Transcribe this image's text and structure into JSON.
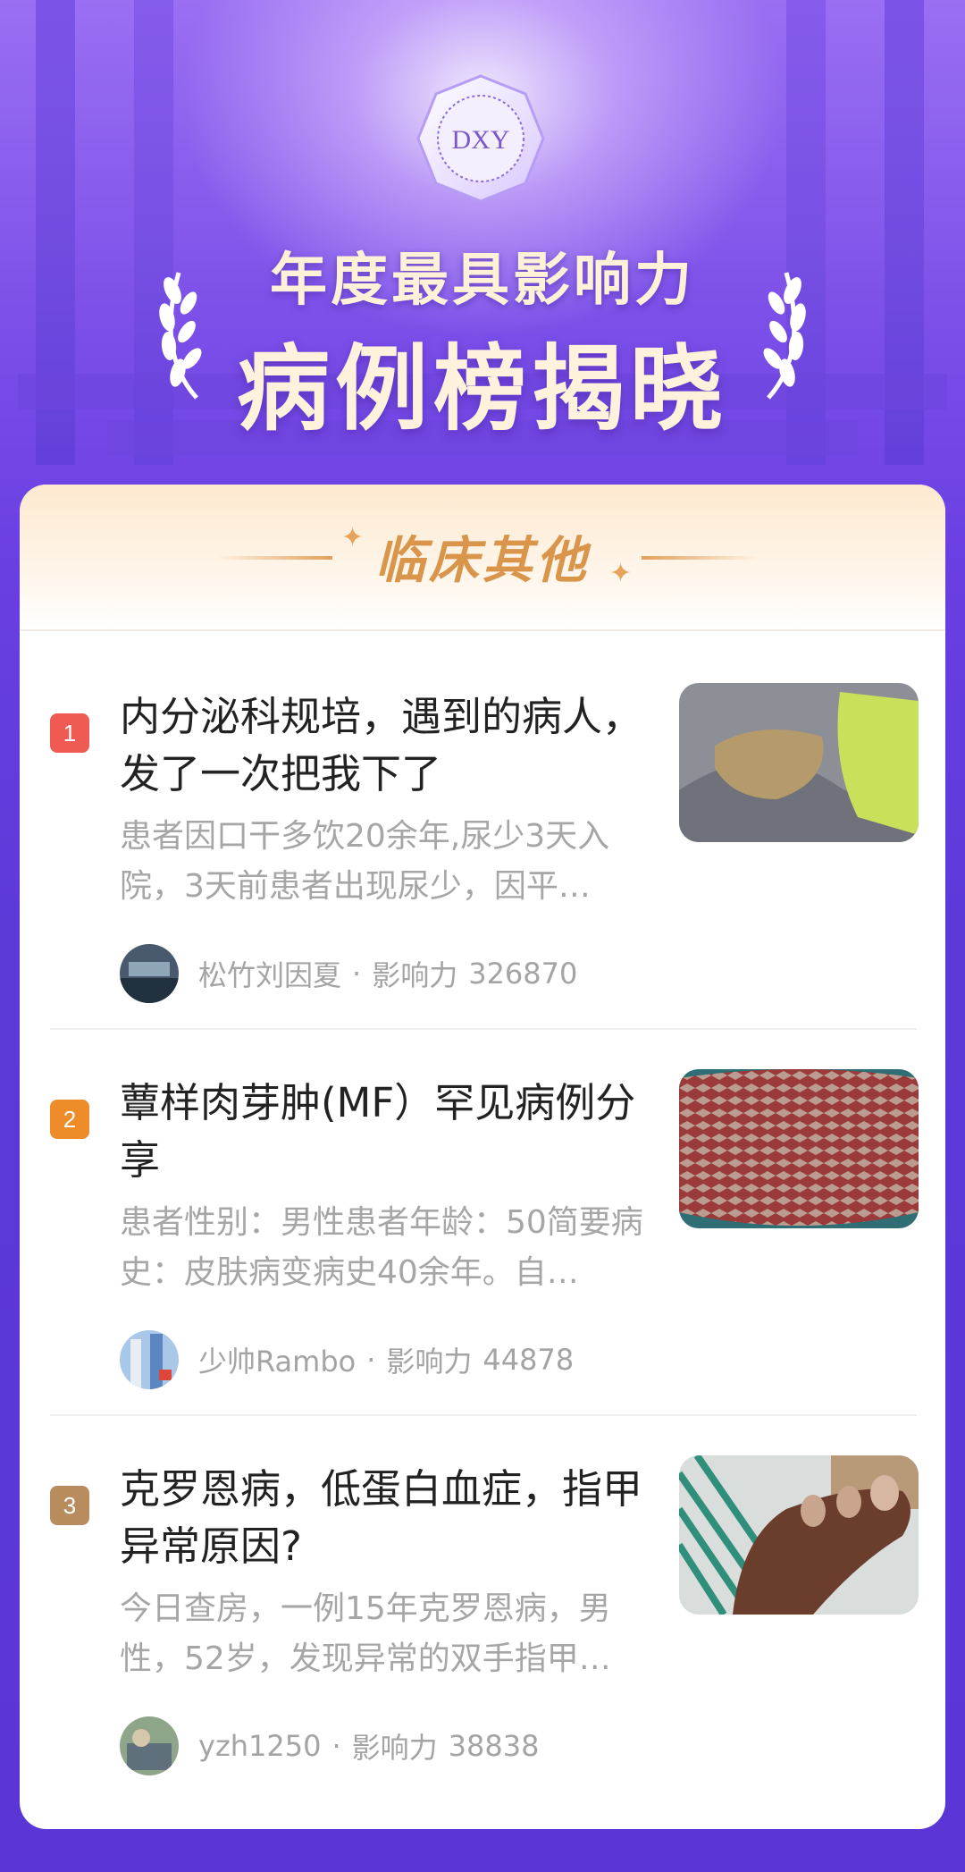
{
  "hero": {
    "emblem_text": "DXY",
    "title_line1": "年度最具影响力",
    "title_line2": "病例榜揭晓"
  },
  "category": {
    "title": "临床其他"
  },
  "items": [
    {
      "rank": "1",
      "rank_color": "#ef5a52",
      "title": "内分泌科规培，遇到的病人，发了一次把我下了",
      "desc": "患者因口干多饮20余年,尿少3天入院，3天前患者出现尿少，因平…",
      "author": "松竹刘因夏",
      "separator": "·",
      "influence_label": "影响力",
      "influence_value": "326870"
    },
    {
      "rank": "2",
      "rank_color": "#ef8c2a",
      "title": "蕈样肉芽肿(MF）罕见病例分享",
      "desc": "患者性别：男性患者年龄：50简要病史：皮肤病变病史40余年。自…",
      "author": "少帅Rambo",
      "separator": "·",
      "influence_label": "影响力",
      "influence_value": "44878"
    },
    {
      "rank": "3",
      "rank_color": "#b98c5e",
      "title": "克罗恩病，低蛋白血症，指甲异常原因?",
      "desc": "今日查房，一例15年克罗恩病，男性，52岁，发现异常的双手指甲…",
      "author": "yzh1250",
      "separator": "·",
      "influence_label": "影响力",
      "influence_value": "38838"
    }
  ]
}
